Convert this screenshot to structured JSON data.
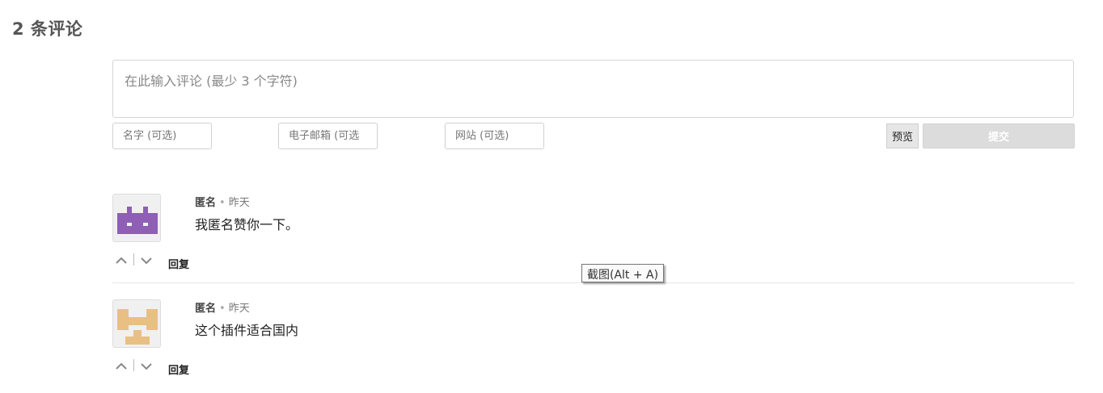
{
  "section": {
    "title": "2 条评论"
  },
  "form": {
    "comment_placeholder": "在此输入评论 (最少 3 个字符)",
    "name_placeholder": "名字 (可选)",
    "email_placeholder": "电子邮箱 (可选",
    "website_placeholder": "网站 (可选)",
    "preview_label": "预览",
    "submit_label": "提交"
  },
  "comments": [
    {
      "author": "匿名",
      "separator": "•",
      "time": "昨天",
      "text": "我匿名赞你一下。",
      "reply_label": "回复",
      "avatar_color": "#8e5fb5",
      "icons": [
        "chevron-up-icon",
        "chevron-down-icon"
      ]
    },
    {
      "author": "匿名",
      "separator": "•",
      "time": "昨天",
      "text": "这个插件适合国内",
      "reply_label": "回复",
      "avatar_color": "#e8c084",
      "icons": [
        "chevron-up-icon",
        "chevron-down-icon"
      ]
    }
  ],
  "tooltip": {
    "text": "截图(Alt + A)"
  }
}
